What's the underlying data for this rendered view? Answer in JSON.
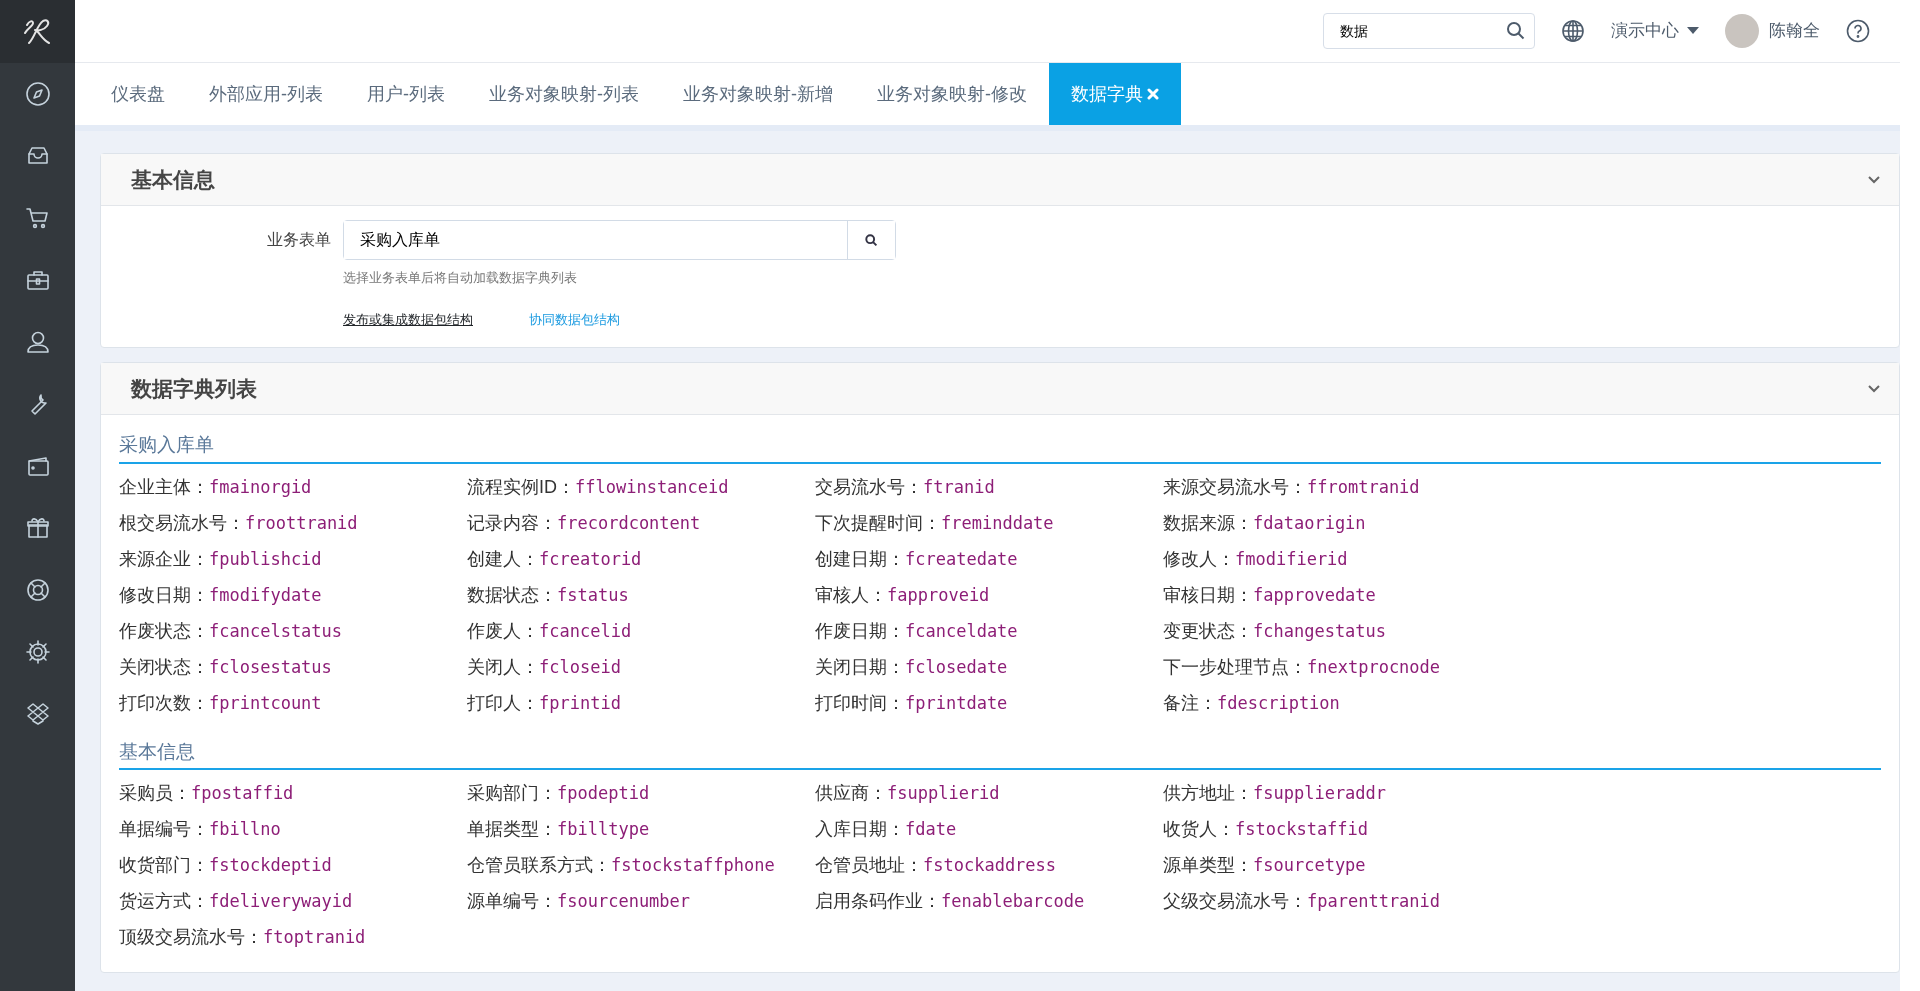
{
  "topbar": {
    "search": {
      "value": "数据"
    },
    "org_menu": "演示中心",
    "user": "陈翰全"
  },
  "tabs": [
    {
      "label": "仪表盘",
      "selected": false
    },
    {
      "label": "外部应用-列表",
      "selected": false
    },
    {
      "label": "用户-列表",
      "selected": false
    },
    {
      "label": "业务对象映射-列表",
      "selected": false
    },
    {
      "label": "业务对象映射-新增",
      "selected": false
    },
    {
      "label": "业务对象映射-修改",
      "selected": false
    },
    {
      "label": "数据字典",
      "selected": true
    }
  ],
  "basic_info": {
    "title": "基本信息",
    "form_label": "业务表单",
    "form_value": "采购入库单",
    "hint": "选择业务表单后将自动加载数据字典列表",
    "links": [
      {
        "label": "发布或集成数据包结构",
        "kind": "dark"
      },
      {
        "label": "协同数据包结构",
        "kind": "accent"
      }
    ]
  },
  "dictionary": {
    "title": "数据字典列表",
    "groups": [
      {
        "title": "采购入库单",
        "fields": [
          {
            "label": "企业主体：",
            "name": "fmainorgid"
          },
          {
            "label": "流程实例ID：",
            "name": "fflowinstanceid"
          },
          {
            "label": "交易流水号：",
            "name": "ftranid"
          },
          {
            "label": "来源交易流水号：",
            "name": "ffromtranid"
          },
          {
            "label": "根交易流水号：",
            "name": "froottranid"
          },
          {
            "label": "记录内容：",
            "name": "frecordcontent"
          },
          {
            "label": "下次提醒时间：",
            "name": "freminddate"
          },
          {
            "label": "数据来源：",
            "name": "fdataorigin"
          },
          {
            "label": "来源企业：",
            "name": "fpublishcid"
          },
          {
            "label": "创建人：",
            "name": "fcreatorid"
          },
          {
            "label": "创建日期：",
            "name": "fcreatedate"
          },
          {
            "label": "修改人：",
            "name": "fmodifierid"
          },
          {
            "label": "修改日期：",
            "name": "fmodifydate"
          },
          {
            "label": "数据状态：",
            "name": "fstatus"
          },
          {
            "label": "审核人：",
            "name": "fapproveid"
          },
          {
            "label": "审核日期：",
            "name": "fapprovedate"
          },
          {
            "label": "作废状态：",
            "name": "fcancelstatus"
          },
          {
            "label": "作废人：",
            "name": "fcancelid"
          },
          {
            "label": "作废日期：",
            "name": "fcanceldate"
          },
          {
            "label": "变更状态：",
            "name": "fchangestatus"
          },
          {
            "label": "关闭状态：",
            "name": "fclosestatus"
          },
          {
            "label": "关闭人：",
            "name": "fcloseid"
          },
          {
            "label": "关闭日期：",
            "name": "fclosedate"
          },
          {
            "label": "下一步处理节点：",
            "name": "fnextprocnode"
          },
          {
            "label": "打印次数：",
            "name": "fprintcount"
          },
          {
            "label": "打印人：",
            "name": "fprintid"
          },
          {
            "label": "打印时间：",
            "name": "fprintdate"
          },
          {
            "label": "备注：",
            "name": "fdescription"
          }
        ]
      },
      {
        "title": "基本信息",
        "fields": [
          {
            "label": "采购员：",
            "name": "fpostaffid"
          },
          {
            "label": "采购部门：",
            "name": "fpodeptid"
          },
          {
            "label": "供应商：",
            "name": "fsupplierid"
          },
          {
            "label": "供方地址：",
            "name": "fsupplieraddr"
          },
          {
            "label": "单据编号：",
            "name": "fbillno"
          },
          {
            "label": "单据类型：",
            "name": "fbilltype"
          },
          {
            "label": "入库日期：",
            "name": "fdate"
          },
          {
            "label": "收货人：",
            "name": "fstockstaffid"
          },
          {
            "label": "收货部门：",
            "name": "fstockdeptid"
          },
          {
            "label": "仓管员联系方式：",
            "name": "fstockstaffphone"
          },
          {
            "label": "仓管员地址：",
            "name": "fstockaddress"
          },
          {
            "label": "源单类型：",
            "name": "fsourcetype"
          },
          {
            "label": "货运方式：",
            "name": "fdeliverywayid"
          },
          {
            "label": "源单编号：",
            "name": "fsourcenumber"
          },
          {
            "label": "启用条码作业：",
            "name": "fenablebarcode"
          },
          {
            "label": "父级交易流水号：",
            "name": "fparenttranid"
          },
          {
            "label": "顶级交易流水号：",
            "name": "ftoptranid"
          }
        ]
      }
    ]
  }
}
